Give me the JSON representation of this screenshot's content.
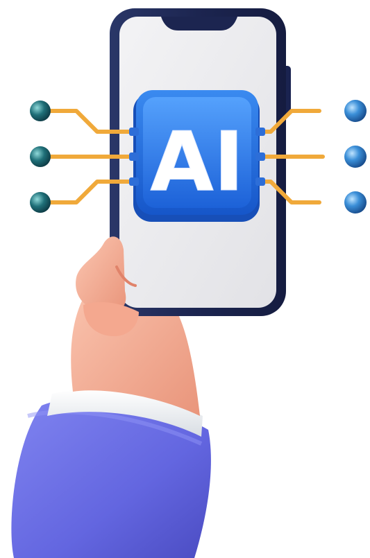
{
  "chip": {
    "label": "AI"
  },
  "colors": {
    "phone_frame": "#1f2a55",
    "phone_screen": "#e9e9ec",
    "chip_blue": "#1f6fe0",
    "chip_blue_light": "#5aa6ff",
    "circuit_gold": "#f0a93a",
    "node_blue": "#3f8fd6",
    "node_teal": "#1f6f78",
    "skin": "#f6b39c",
    "cuff_white": "#eef1f4",
    "sleeve_purple": "#6b6fe6"
  },
  "icons": [
    "smartphone-icon",
    "ai-chip-icon",
    "hand-icon",
    "circuit-icon"
  ]
}
